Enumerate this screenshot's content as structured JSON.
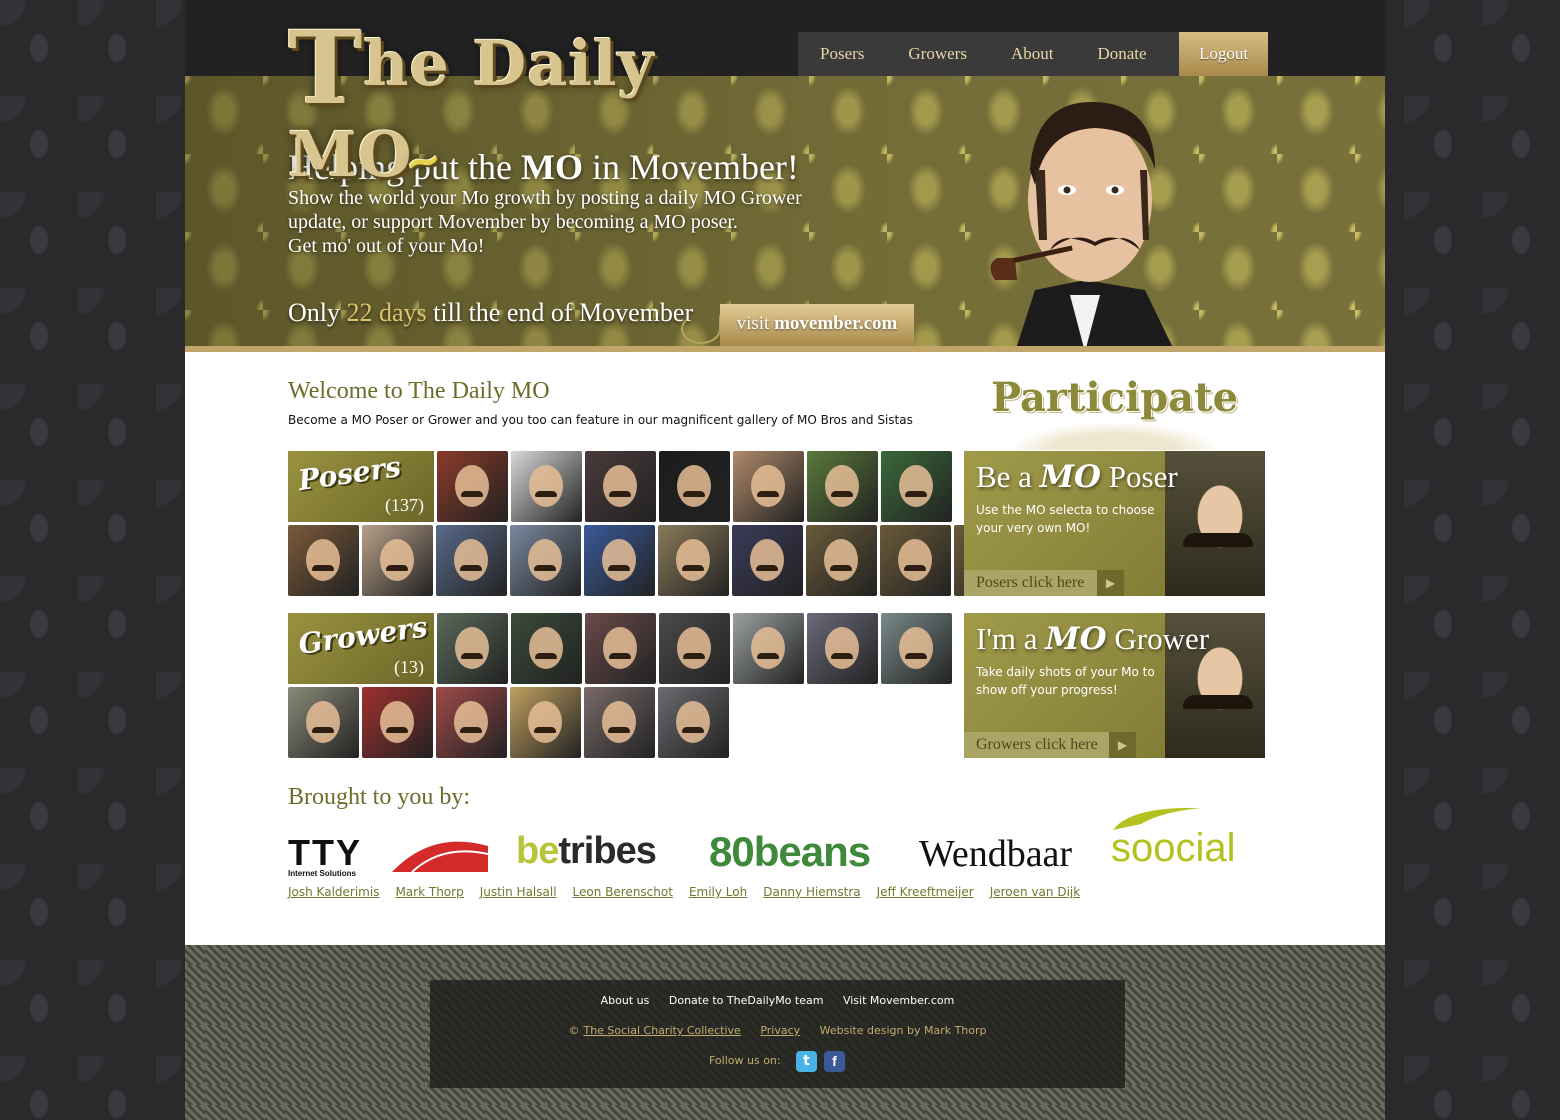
{
  "logo": {
    "text": "The Daily MO",
    "big_letter": "T",
    "rest": "he Daily MO"
  },
  "nav": {
    "items": [
      {
        "label": "Posers"
      },
      {
        "label": "Growers"
      },
      {
        "label": "About"
      },
      {
        "label": "Donate"
      }
    ],
    "logout_label": "Logout"
  },
  "hero": {
    "headline_pre": "Helping put the ",
    "headline_bold": "MO",
    "headline_post": " in Movember!",
    "line1": "Show the world your Mo growth by posting a daily MO Grower",
    "line2": "update, or support Movember by becoming a MO poser.",
    "line3": "Get mo' out of your Mo!",
    "countdown_pre": "Only ",
    "countdown_days": "22 days",
    "countdown_post": " till the end of Movember",
    "visit_pre": "visit ",
    "visit_bold": "movember.com"
  },
  "welcome": {
    "title": "Welcome to The Daily MO",
    "text": "Become a MO Poser or Grower and you too can feature in our magnificent gallery of MO Bros and Sistas"
  },
  "posers": {
    "label": "Posers",
    "count": "(137)",
    "thumb_colors": [
      "#8a3a2a",
      "#d8d8d8",
      "#4a3a3a",
      "#1c1c1c",
      "#b08a6a",
      "#5a7a3a",
      "#3a6a3a",
      "#7a5a3a",
      "#b8a08a",
      "#5a6a8a",
      "#7a8aa0",
      "#3a5a9a",
      "#8a7a5a",
      "#3a3a5a",
      "#6a5a3a",
      "#6a5a3a",
      "#6a5a3a"
    ]
  },
  "growers": {
    "label": "Growers",
    "count": "(13)",
    "thumb_colors": [
      "#5a6a5a",
      "#3a4a3a",
      "#6a4a4a",
      "#4a4a4a",
      "#9aa0a0",
      "#6a6a7a",
      "#7a8a8a",
      "#8a8a7a",
      "#a03030",
      "#a04a4a",
      "#c0a060",
      "#7a6a6a",
      "#6a6a70"
    ]
  },
  "participate": {
    "title": "Participate",
    "poser": {
      "head_pre": "Be a ",
      "head_mo": "MO",
      "head_post": " Poser",
      "desc": "Use the MO selecta to choose your very own MO!",
      "button": "Posers click here"
    },
    "grower": {
      "head_pre": "I'm a ",
      "head_mo": "MO",
      "head_post": " Grower",
      "desc": "Take daily shots of your Mo to show off your progress!",
      "button": "Growers click here"
    }
  },
  "brought": {
    "title": "Brought to you by:",
    "sponsors": {
      "tty": "TTY",
      "tty_sub": "Internet Solutions",
      "betribes_be": "be",
      "betribes_rest": "tribes",
      "beans": "80beans",
      "wendbaar": "Wendbaar",
      "soocial": "soocial"
    },
    "names": [
      "Josh Kalderimis",
      "Mark Thorp",
      "Justin Halsall",
      "Leon Berenschot",
      "Emily Loh",
      "Danny Hiemstra",
      "Jeff Kreeftmeijer",
      "Jeroen van Dijk"
    ]
  },
  "footer": {
    "links": [
      "About us",
      "Donate to TheDailyMo team",
      "Visit Movember.com"
    ],
    "copyright": "©",
    "collective": "The Social Charity Collective",
    "privacy": "Privacy",
    "design": "Website design by Mark Thorp",
    "follow": "Follow us on:",
    "twitter_glyph": "t",
    "facebook_glyph": "f"
  },
  "colors": {
    "accent_olive": "#6d6d2b",
    "gold": "#c2a568",
    "hero_olive": "#78713a"
  }
}
